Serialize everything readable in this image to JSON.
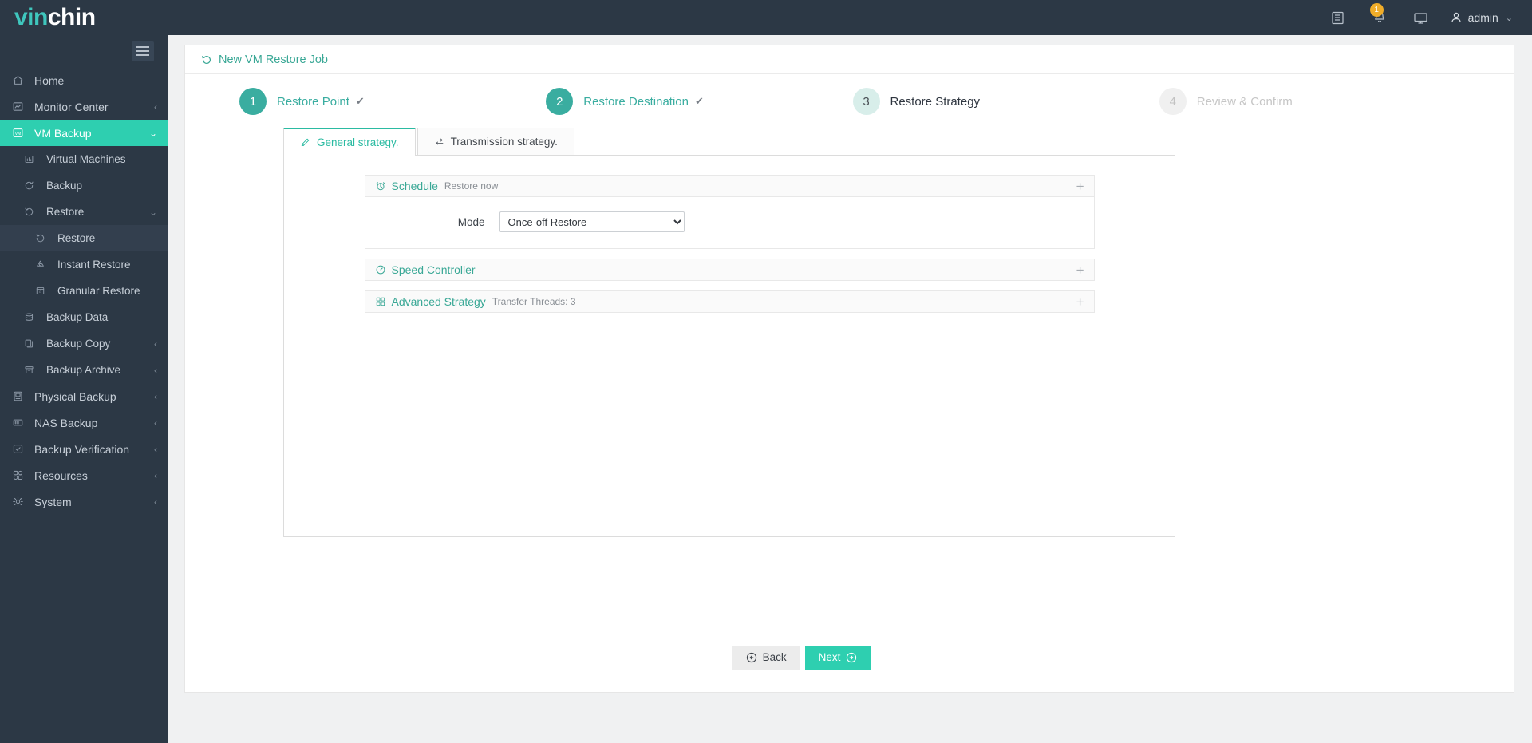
{
  "brand": {
    "part1": "vin",
    "part2": "chin"
  },
  "topbar": {
    "icons": [
      {
        "name": "logs-icon",
        "glyph": "list"
      },
      {
        "name": "notification-bell-icon",
        "glyph": "bell",
        "badge": "1"
      },
      {
        "name": "monitor-icon",
        "glyph": "monitor"
      }
    ],
    "user_label": "admin",
    "user_chevron": "⌄"
  },
  "sidebar": {
    "items": [
      {
        "label": "Home",
        "icon": "home-icon",
        "level": 1,
        "arrow": "",
        "state": ""
      },
      {
        "label": "Monitor Center",
        "icon": "monitor-center-icon",
        "level": 1,
        "arrow": "‹",
        "state": ""
      },
      {
        "label": "VM Backup",
        "icon": "vm-backup-icon",
        "level": 1,
        "arrow": "⌄",
        "state": "active"
      },
      {
        "label": "Virtual Machines",
        "icon": "virtual-machines-icon",
        "level": 2,
        "arrow": "",
        "state": ""
      },
      {
        "label": "Backup",
        "icon": "backup-icon",
        "level": 2,
        "arrow": "",
        "state": ""
      },
      {
        "label": "Restore",
        "icon": "restore-icon",
        "level": 2,
        "arrow": "⌄",
        "state": ""
      },
      {
        "label": "Restore",
        "icon": "restore-icon",
        "level": 3,
        "arrow": "",
        "state": "subactive"
      },
      {
        "label": "Instant Restore",
        "icon": "instant-restore-icon",
        "level": 3,
        "arrow": "",
        "state": ""
      },
      {
        "label": "Granular Restore",
        "icon": "granular-restore-icon",
        "level": 3,
        "arrow": "",
        "state": ""
      },
      {
        "label": "Backup Data",
        "icon": "backup-data-icon",
        "level": 2,
        "arrow": "",
        "state": ""
      },
      {
        "label": "Backup Copy",
        "icon": "backup-copy-icon",
        "level": 2,
        "arrow": "‹",
        "state": ""
      },
      {
        "label": "Backup Archive",
        "icon": "backup-archive-icon",
        "level": 2,
        "arrow": "‹",
        "state": ""
      },
      {
        "label": "Physical Backup",
        "icon": "physical-backup-icon",
        "level": 1,
        "arrow": "‹",
        "state": ""
      },
      {
        "label": "NAS Backup",
        "icon": "nas-backup-icon",
        "level": 1,
        "arrow": "‹",
        "state": ""
      },
      {
        "label": "Backup Verification",
        "icon": "backup-verification-icon",
        "level": 1,
        "arrow": "‹",
        "state": ""
      },
      {
        "label": "Resources",
        "icon": "resources-icon",
        "level": 1,
        "arrow": "‹",
        "state": ""
      },
      {
        "label": "System",
        "icon": "system-icon",
        "level": 1,
        "arrow": "‹",
        "state": ""
      }
    ]
  },
  "page": {
    "title": "New VM Restore Job",
    "title_icon": "restore-icon"
  },
  "stepper": {
    "steps": [
      {
        "num": "1",
        "label": "Restore Point",
        "state": "done",
        "check": "✔"
      },
      {
        "num": "2",
        "label": "Restore Destination",
        "state": "done",
        "check": "✔"
      },
      {
        "num": "3",
        "label": "Restore Strategy",
        "state": "current",
        "check": ""
      },
      {
        "num": "4",
        "label": "Review & Confirm",
        "state": "disabled",
        "check": ""
      }
    ]
  },
  "tabs": [
    {
      "label": "General strategy.",
      "icon": "pencil-icon",
      "active": true
    },
    {
      "label": "Transmission strategy.",
      "icon": "transfer-arrows-icon",
      "active": false
    }
  ],
  "sections": [
    {
      "name": "Schedule",
      "icon": "alarm-clock-icon",
      "summary": "Restore now",
      "expanded": true,
      "toggle": "+",
      "fields": [
        {
          "label": "Mode",
          "type": "select",
          "value": "Once-off Restore",
          "options": [
            "Once-off Restore"
          ]
        }
      ]
    },
    {
      "name": "Speed Controller",
      "icon": "speedometer-icon",
      "summary": "",
      "expanded": false,
      "toggle": "+",
      "fields": []
    },
    {
      "name": "Advanced Strategy",
      "icon": "grid-blocks-icon",
      "summary": "Transfer Threads: 3",
      "expanded": false,
      "toggle": "+",
      "fields": []
    }
  ],
  "footer": {
    "back_label": "Back",
    "next_label": "Next"
  },
  "colors": {
    "brand_teal": "#2ecfb0",
    "header_dark": "#2c3845",
    "step_teal": "#3aada0",
    "badge_orange": "#f0ad29"
  }
}
